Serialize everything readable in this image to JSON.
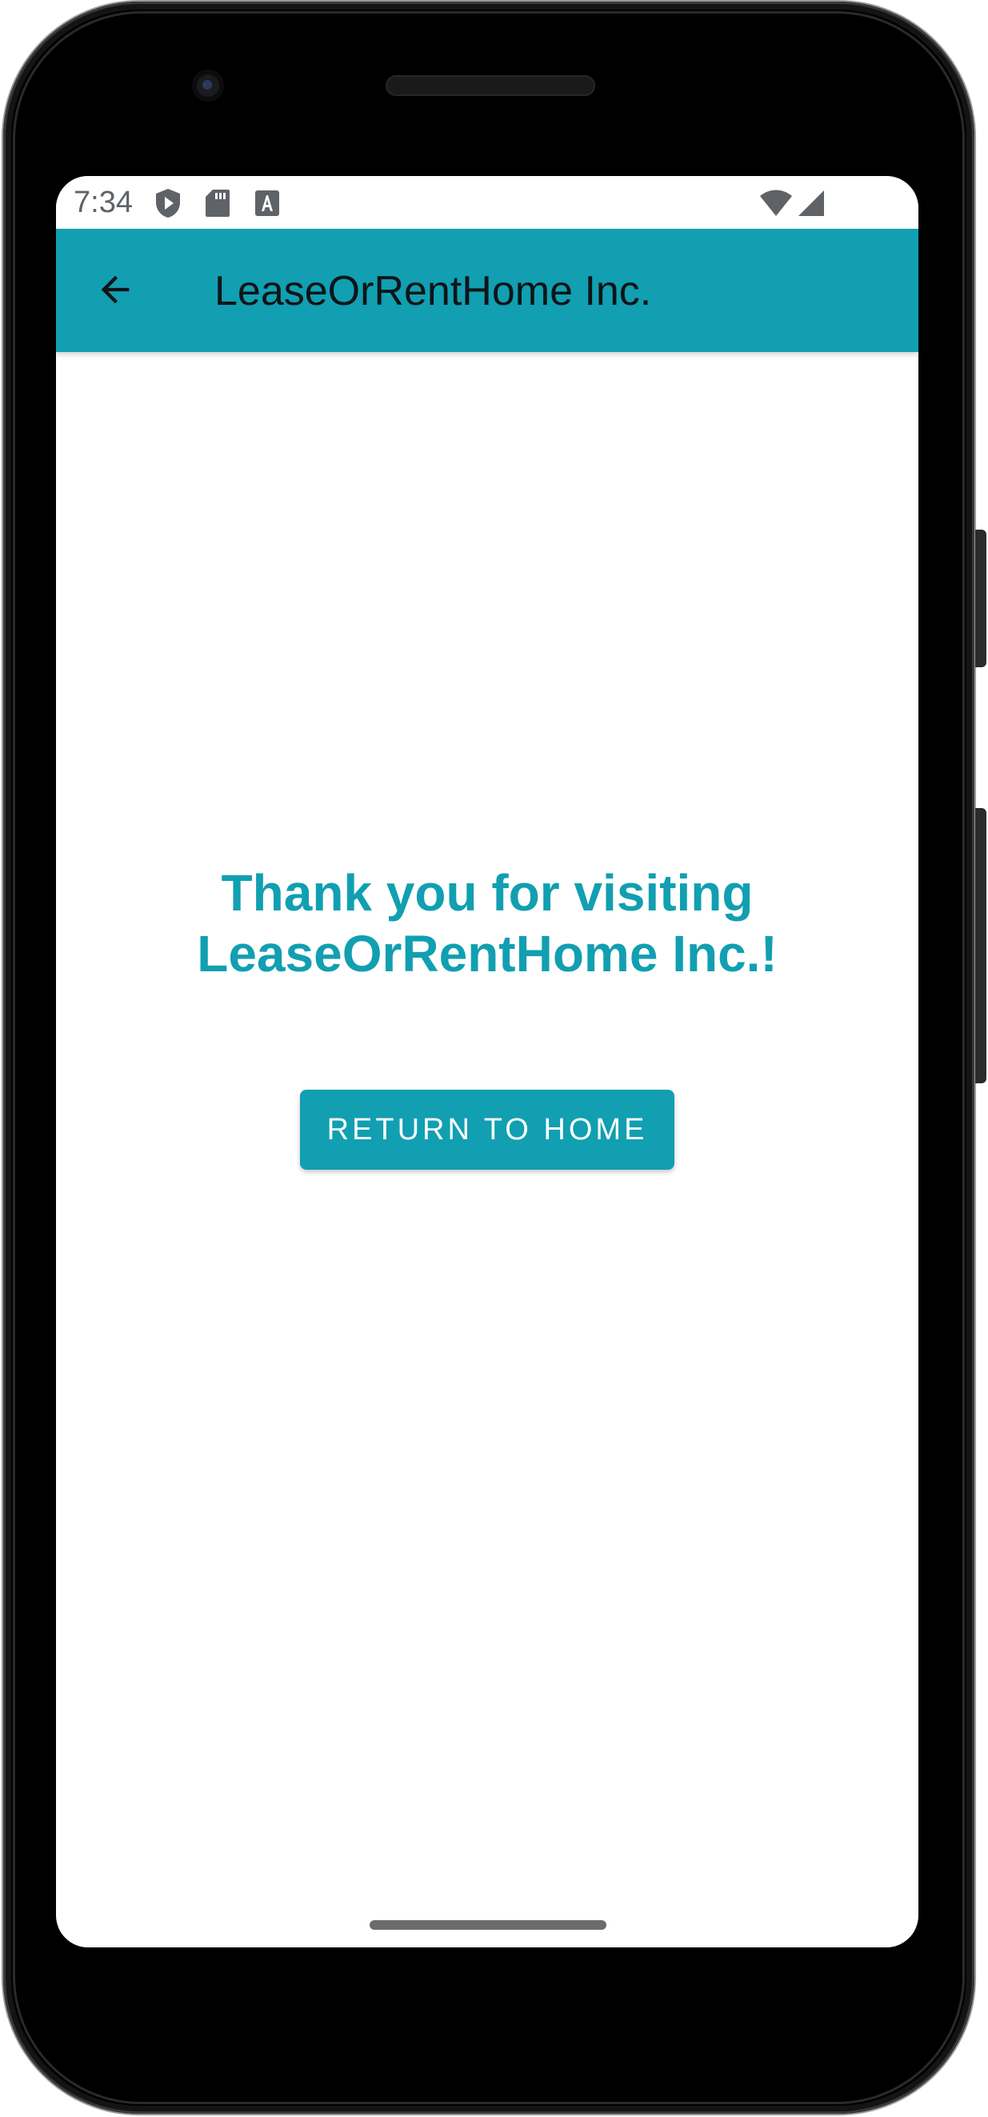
{
  "status_bar": {
    "time": "7:34",
    "left_icons": [
      "shield-play-icon",
      "sd-card-icon",
      "text-a-icon"
    ],
    "right_icons": [
      "wifi-icon",
      "cellular-signal-icon"
    ]
  },
  "app_bar": {
    "back_icon": "arrow-back-icon",
    "title": "LeaseOrRentHome Inc."
  },
  "main": {
    "message": "Thank you for visiting LeaseOrRentHome Inc.!",
    "return_button_label": "RETURN TO HOME"
  },
  "colors": {
    "accent": "#119fb1",
    "title_text": "#101417",
    "status_icon": "#5f6368",
    "background": "#ffffff"
  }
}
